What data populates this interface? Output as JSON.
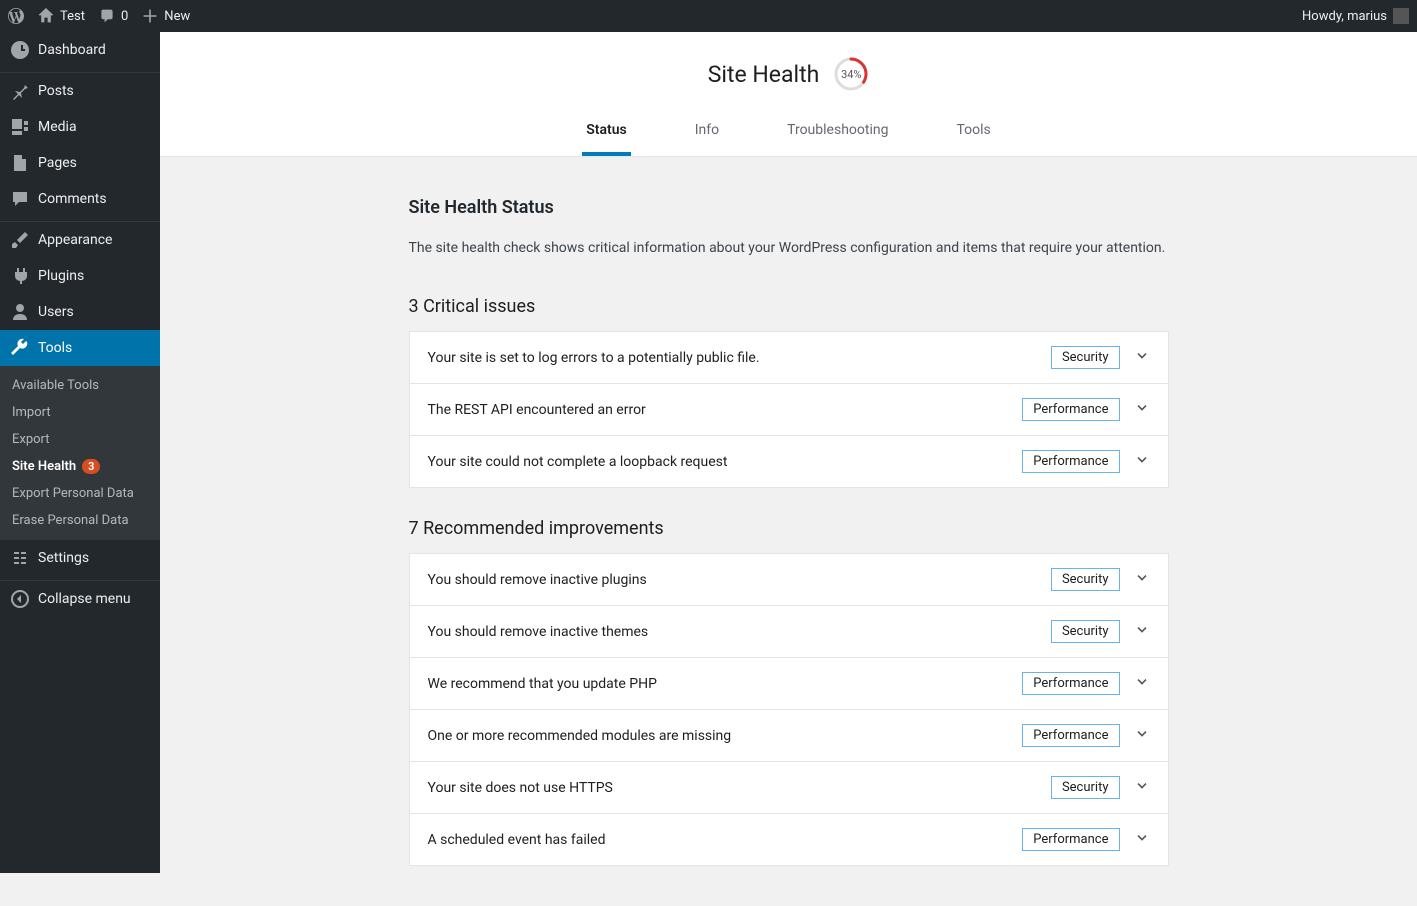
{
  "adminbar": {
    "site_name": "Test",
    "comments_count": "0",
    "new_label": "New",
    "howdy": "Howdy, marius"
  },
  "sidebar": {
    "items": [
      {
        "label": "Dashboard"
      },
      {
        "label": "Posts"
      },
      {
        "label": "Media"
      },
      {
        "label": "Pages"
      },
      {
        "label": "Comments"
      },
      {
        "label": "Appearance"
      },
      {
        "label": "Plugins"
      },
      {
        "label": "Users"
      },
      {
        "label": "Tools"
      },
      {
        "label": "Settings"
      }
    ],
    "tools_submenu": [
      {
        "label": "Available Tools"
      },
      {
        "label": "Import"
      },
      {
        "label": "Export"
      },
      {
        "label": "Site Health",
        "badge": "3"
      },
      {
        "label": "Export Personal Data"
      },
      {
        "label": "Erase Personal Data"
      }
    ],
    "collapse": "Collapse menu"
  },
  "health": {
    "title": "Site Health",
    "progress": "34%",
    "progress_value": 34,
    "tabs": [
      {
        "label": "Status"
      },
      {
        "label": "Info"
      },
      {
        "label": "Troubleshooting"
      },
      {
        "label": "Tools"
      }
    ],
    "status_heading": "Site Health Status",
    "status_desc": "The site health check shows critical information about your WordPress configuration and items that require your attention.",
    "critical_heading": "3 Critical issues",
    "critical": [
      {
        "title": "Your site is set to log errors to a potentially public file.",
        "badge": "Security",
        "badge_class": "security"
      },
      {
        "title": "The REST API encountered an error",
        "badge": "Performance",
        "badge_class": "performance"
      },
      {
        "title": "Your site could not complete a loopback request",
        "badge": "Performance",
        "badge_class": "performance"
      }
    ],
    "recommended_heading": "7 Recommended improvements",
    "recommended": [
      {
        "title": "You should remove inactive plugins",
        "badge": "Security",
        "badge_class": "security"
      },
      {
        "title": "You should remove inactive themes",
        "badge": "Security",
        "badge_class": "security"
      },
      {
        "title": "We recommend that you update PHP",
        "badge": "Performance",
        "badge_class": "performance"
      },
      {
        "title": "One or more recommended modules are missing",
        "badge": "Performance",
        "badge_class": "performance"
      },
      {
        "title": "Your site does not use HTTPS",
        "badge": "Security",
        "badge_class": "security"
      },
      {
        "title": "A scheduled event has failed",
        "badge": "Performance",
        "badge_class": "performance"
      }
    ]
  }
}
